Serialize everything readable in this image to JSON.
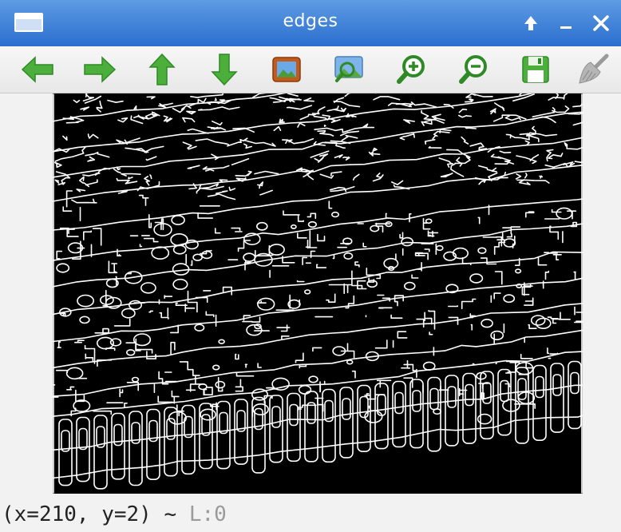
{
  "window": {
    "title": "edges"
  },
  "titlebar": {
    "buttons": [
      {
        "name": "keep-above-button",
        "glyph": "↑"
      },
      {
        "name": "minimize-button",
        "glyph": "–"
      },
      {
        "name": "close-button",
        "glyph": "✕"
      }
    ]
  },
  "toolbar": {
    "tools": [
      {
        "name": "pan-left",
        "icon": "arrow-left-icon"
      },
      {
        "name": "pan-right",
        "icon": "arrow-right-icon"
      },
      {
        "name": "pan-up",
        "icon": "arrow-up-icon"
      },
      {
        "name": "pan-down",
        "icon": "arrow-down-icon"
      },
      {
        "name": "reset-zoom",
        "icon": "picture-icon"
      },
      {
        "name": "zoom-to-fit",
        "icon": "zoom-image-icon"
      },
      {
        "name": "zoom-in",
        "icon": "zoom-in-icon"
      },
      {
        "name": "zoom-out",
        "icon": "zoom-out-icon"
      },
      {
        "name": "save-image",
        "icon": "save-icon"
      },
      {
        "name": "properties",
        "icon": "brush-icon"
      }
    ]
  },
  "image": {
    "description": "Canny edge map (white edges on black)"
  },
  "status": {
    "coords": "(x=210, y=2)",
    "separator": "~",
    "value": "L:0"
  },
  "colors": {
    "titlebar": "#3a7fd8",
    "icon_green": "#4caf3c",
    "edge": "#ffffff",
    "background": "#000000"
  }
}
